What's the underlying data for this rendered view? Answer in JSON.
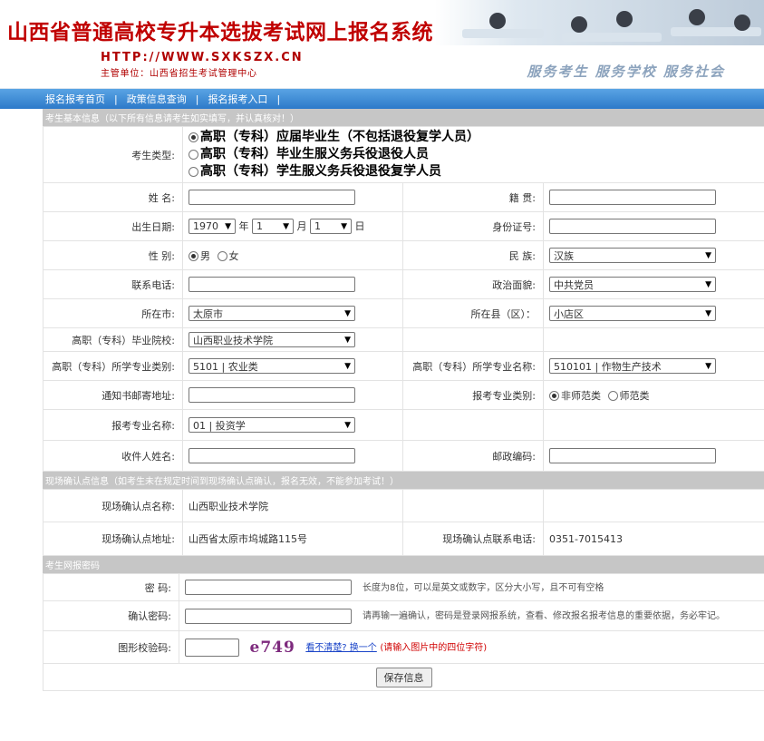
{
  "header": {
    "title": "山西省普通高校专升本选拔考试网上报名系统",
    "url": "HTTP://WWW.SXKSZX.CN",
    "org": "主管单位：山西省招生考试管理中心",
    "slogan": "服务考生  服务学校  服务社会"
  },
  "nav": {
    "items": [
      "报名报考首页",
      "政策信息查询",
      "报名报考入口"
    ]
  },
  "basic": {
    "section": "考生基本信息（以下所有信息请考生如实填写，并认真核对！）",
    "type_label": "考生类型:",
    "type_options": [
      "高职（专科）应届毕业生（不包括退役复学人员）",
      "高职（专科）毕业生服义务兵役退役人员",
      "高职（专科）学生服义务兵役退役复学人员"
    ],
    "name_label": "姓  名:",
    "native_label": "籍  贯:",
    "birth_label": "出生日期:",
    "birth_year": "1970",
    "birth_month": "1",
    "birth_day": "1",
    "year_unit": "年",
    "month_unit": "月",
    "day_unit": "日",
    "id_label": "身份证号:",
    "gender_label": "性  别:",
    "male": "男",
    "female": "女",
    "nation_label": "民  族:",
    "nation_value": "汉族",
    "phone_label": "联系电话:",
    "politics_label": "政治面貌:",
    "politics_value": "中共党员",
    "city_label": "所在市:",
    "city_value": "太原市",
    "county_label": "所在县（区）：",
    "county_value": "小店区",
    "school_label": "高职（专科）毕业院校:",
    "school_value": "山西职业技术学院",
    "major_cat_label": "高职（专科）所学专业类别:",
    "major_cat_value": "5101 | 农业类",
    "major_name_label": "高职（专科）所学专业名称:",
    "major_name_value": "510101 | 作物生产技术",
    "mail_label": "通知书邮寄地址:",
    "apply_cat_label": "报考专业类别:",
    "apply_cat_opt1": "非师范类",
    "apply_cat_opt2": "师范类",
    "apply_major_label": "报考专业名称:",
    "apply_major_value": "01 | 投资学",
    "recipient_label": "收件人姓名:",
    "postcode_label": "邮政编码:"
  },
  "confirm": {
    "section": "现场确认点信息（如考生未在规定时间到现场确认点确认，报名无效，不能参加考试！）",
    "name_label": "现场确认点名称:",
    "name_value": "山西职业技术学院",
    "addr_label": "现场确认点地址:",
    "addr_value": "山西省太原市坞城路115号",
    "phone_label": "现场确认点联系电话:",
    "phone_value": "0351-7015413"
  },
  "password": {
    "section": "考生网报密码",
    "pwd_label": "密  码:",
    "pwd_hint": "长度为8位，可以是英文或数字，区分大小写，且不可有空格",
    "confirm_label": "确认密码:",
    "confirm_hint": "请再输一遍确认，密码是登录网报系统，查看、修改报名报考信息的重要依据，务必牢记。",
    "captcha_label": "图形校验码:",
    "captcha_text": "e749",
    "captcha_link": "看不清楚? 换一个",
    "captcha_hint": "(请输入图片中的四位字符)",
    "save": "保存信息"
  }
}
